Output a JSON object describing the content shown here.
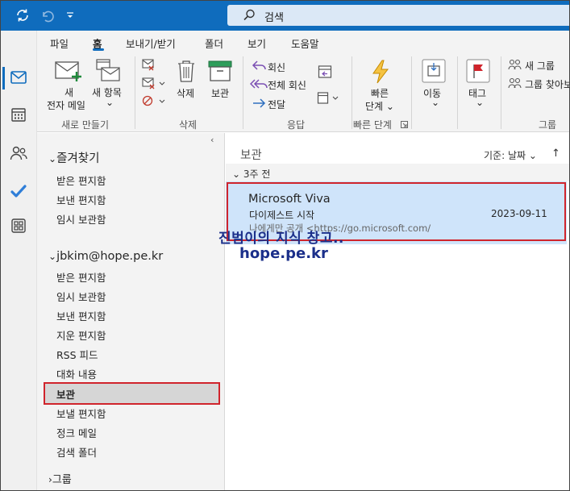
{
  "search": {
    "placeholder": "검색"
  },
  "colors": {
    "brand": "#0f6cbd",
    "highlight": "#d0242c",
    "selected_message": "#cfe4fa"
  },
  "titlebar": {
    "icons": [
      "sync-icon",
      "undo-icon",
      "customize-icon"
    ]
  },
  "navrail": {
    "icons": [
      "mail-icon",
      "calendar-icon",
      "people-icon",
      "todo-icon",
      "apps-icon"
    ]
  },
  "ribbon": {
    "tabs": [
      "파일",
      "홈",
      "보내기/받기",
      "폴더",
      "보기",
      "도움말"
    ],
    "active_tab": "홈",
    "new_email": [
      "새",
      "전자 메일"
    ],
    "new_items": [
      "새 항목",
      "⌄"
    ],
    "delete": "삭제",
    "archive": "보관",
    "reply": "회신",
    "reply_all": "전체 회신",
    "forward": "전달",
    "quick_steps": [
      "빠른",
      "단계 ⌄"
    ],
    "move": [
      "이동",
      "⌄"
    ],
    "tags": [
      "태그",
      "⌄"
    ],
    "new_group": "새 그룹",
    "browse_groups": "그룹 찾아보",
    "groups": {
      "new": "새로 만들기",
      "delete": "삭제",
      "respond": "응답",
      "quick_steps": "빠른 단계",
      "group": "그룹"
    }
  },
  "folders": {
    "favorites_header": "즐겨찾기",
    "favorites": [
      "받은 편지함",
      "보낸 편지함",
      "임시 보관함"
    ],
    "account_header": "jbkim@hope.pe.kr",
    "account_folders": [
      "받은 편지함",
      "임시 보관함",
      "보낸 편지함",
      "지운 편지함",
      "RSS 피드",
      "대화 내용",
      "보관",
      "보낼 편지함",
      "정크 메일",
      "검색 폴더"
    ],
    "groups_header": "그룹"
  },
  "list": {
    "title": "보관",
    "sort": "기준: 날짜 ⌄",
    "sort_arrow": "↑",
    "group_label": "3주 전",
    "messages": [
      {
        "sender": "Microsoft Viva",
        "subject": "다이제스트 시작",
        "date": "2023-09-11",
        "preview": "나에게만 공개 <https://go.microsoft.com/"
      }
    ]
  },
  "watermark": {
    "line1": "진범이의 지식 창고..",
    "line2": "hope.pe.kr"
  }
}
